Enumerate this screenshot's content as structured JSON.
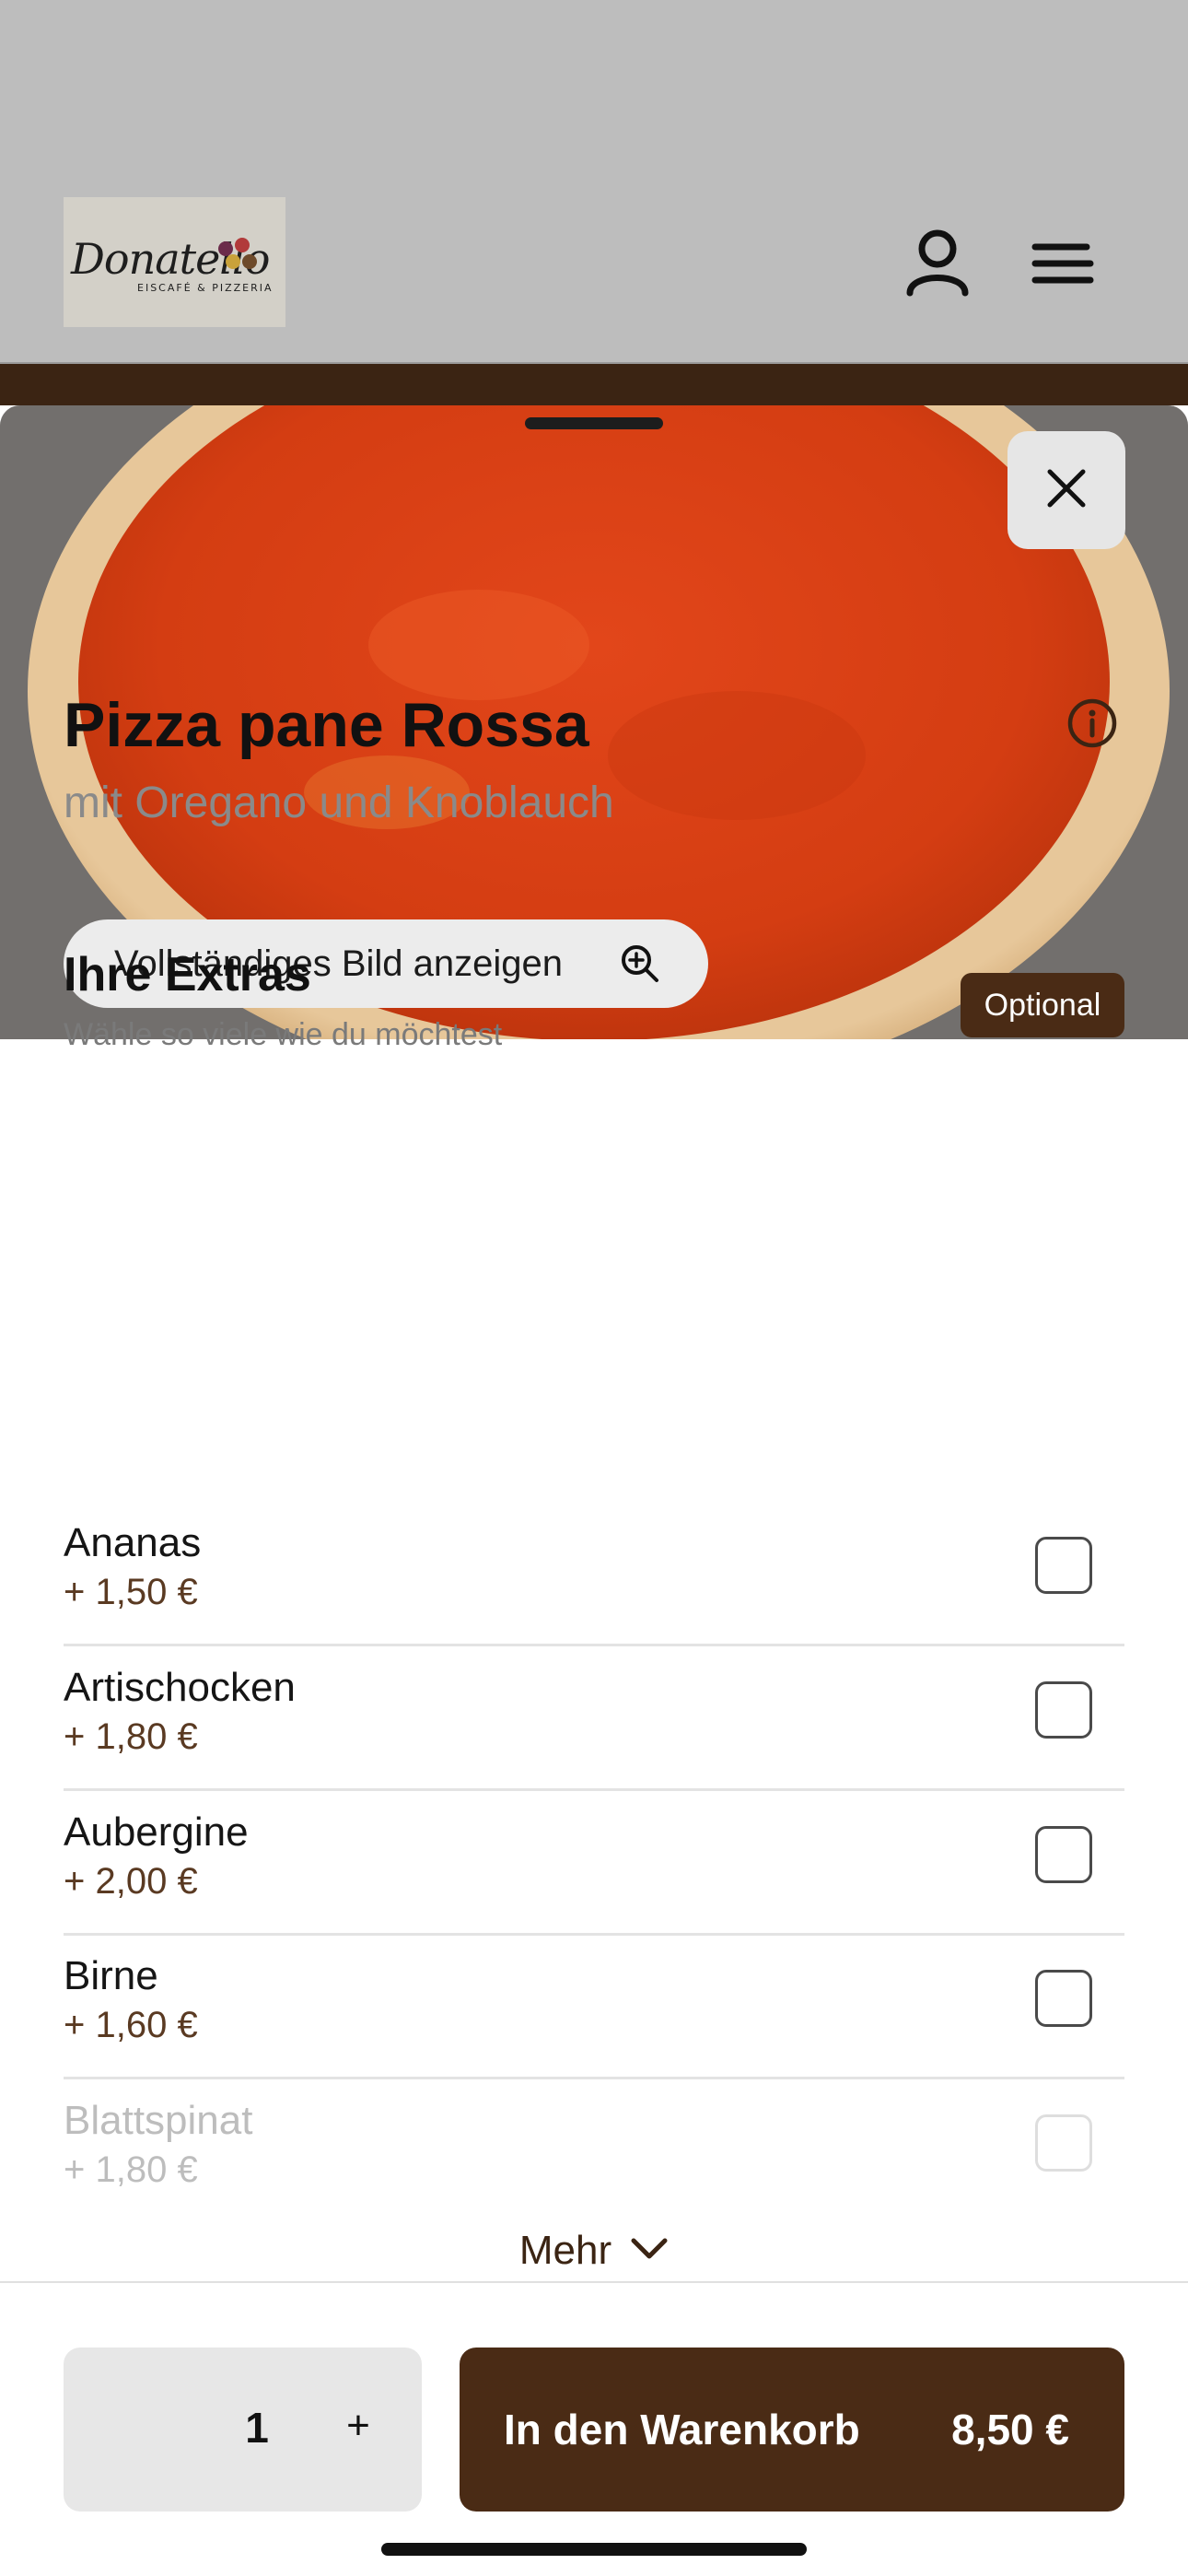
{
  "header": {
    "logo_text": "Donatello",
    "logo_subtext": "EISCAFÉ & PIZZERIA",
    "account_icon": "user-icon",
    "menu_icon": "hamburger-icon"
  },
  "hero": {
    "close_icon": "close-icon",
    "full_image_label": "Vollständiges Bild anzeigen",
    "zoom_icon": "zoom-in-icon"
  },
  "product": {
    "title": "Pizza pane Rossa",
    "subtitle": "mit Oregano und Knoblauch",
    "info_icon": "info-icon"
  },
  "extras": {
    "title": "Ihre Extras",
    "hint": "Wähle so viele wie du möchtest",
    "badge": "Optional",
    "options": [
      {
        "name": "Ananas",
        "price": "+ 1,50 €",
        "checked": false
      },
      {
        "name": "Artischocken",
        "price": "+ 1,80 €",
        "checked": false
      },
      {
        "name": "Aubergine",
        "price": "+ 2,00 €",
        "checked": false
      },
      {
        "name": "Birne",
        "price": "+ 1,60 €",
        "checked": false
      },
      {
        "name": "Blattspinat",
        "price": "+ 1,80 €",
        "checked": false
      }
    ],
    "more_label": "Mehr",
    "more_icon": "chevron-down-icon"
  },
  "footer": {
    "quantity": "1",
    "plus_label": "+",
    "cart_label": "In den Warenkorb",
    "cart_price": "8,50 €"
  },
  "colors": {
    "brand_brown": "#4a2b15",
    "header_gray": "#bdbdbd"
  }
}
